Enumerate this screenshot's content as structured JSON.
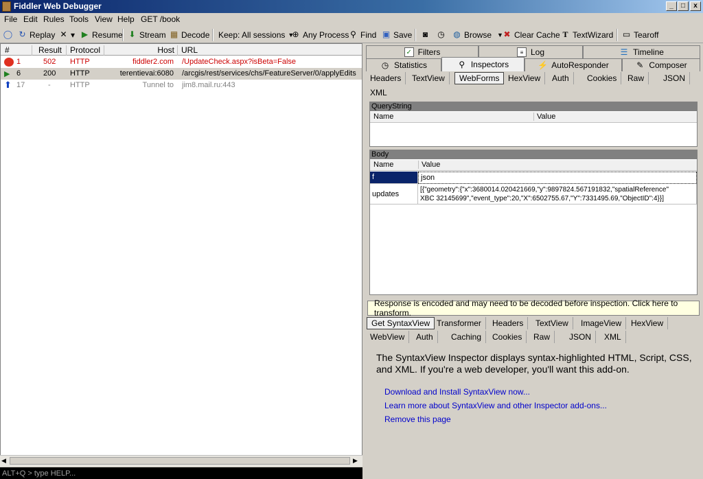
{
  "window": {
    "title": "Fiddler Web Debugger",
    "min": "_",
    "max": "□",
    "close": "x"
  },
  "menu": [
    "File",
    "Edit",
    "Rules",
    "Tools",
    "View",
    "Help",
    "GET /book"
  ],
  "toolbar": {
    "replay": "Replay",
    "remove": "▾",
    "resume": "Resume",
    "stream": "Stream",
    "decode": "Decode",
    "keep": "Keep: All sessions",
    "process": "Any Process",
    "find": "Find",
    "save": "Save",
    "browse": "Browse",
    "clear_cache": "Clear Cache",
    "textwizard": "TextWizard",
    "tearoff": "Tearoff"
  },
  "sessions": {
    "columns": [
      "#",
      "Result",
      "Protocol",
      "Host",
      "URL"
    ],
    "rows": [
      {
        "id": "1",
        "result": "502",
        "protocol": "HTTP",
        "host": "fiddler2.com",
        "url": "/UpdateCheck.aspx?isBeta=False",
        "color": "#cc0000"
      },
      {
        "id": "6",
        "result": "200",
        "protocol": "HTTP",
        "host": "terentievai:6080",
        "url": "/arcgis/rest/services/chs/FeatureServer/0/applyEdits",
        "color": "#000000"
      },
      {
        "id": "17",
        "result": "-",
        "protocol": "HTTP",
        "host": "Tunnel to",
        "url": "jim8.mail.ru:443",
        "color": "#808080"
      }
    ]
  },
  "quickexec": "ALT+Q > type HELP...",
  "tabs_top": [
    "Filters",
    "Log",
    "Timeline"
  ],
  "tabs_main": [
    "Statistics",
    "Inspectors",
    "AutoResponder",
    "Composer"
  ],
  "request_tabs": [
    "Headers",
    "TextView",
    "WebForms",
    "HexView",
    "Auth",
    "Cookies",
    "Raw",
    "JSON",
    "XML"
  ],
  "querystring": {
    "title": "QueryString",
    "col_name": "Name",
    "col_value": "Value"
  },
  "body": {
    "title": "Body",
    "col_name": "Name",
    "col_value": "Value",
    "rows": [
      {
        "name": "f",
        "value": "json"
      },
      {
        "name": "updates",
        "value_line1": "[{\"geometry\":{\"x\":3680014.020421669,\"y\":9897824.567191832,\"spatialReference\"",
        "value_line2": "XBC 32145699\",\"event_type\":20,\"X\":6502755.67,\"Y\":7331495.69,\"ObjectID\":4}}]"
      }
    ]
  },
  "warning": "Response is encoded and may need to be decoded before inspection. Click here to transform.",
  "response_tabs_row1": [
    "Get SyntaxView",
    "Transformer",
    "Headers",
    "TextView",
    "ImageView",
    "HexView"
  ],
  "response_tabs_row2": [
    "WebView",
    "Auth",
    "Caching",
    "Cookies",
    "Raw",
    "JSON",
    "XML"
  ],
  "syntaxview": {
    "message": "The SyntaxView Inspector displays syntax-highlighted HTML, Script, CSS, and XML. If you're a web developer, you'll want this add-on.",
    "link1": "Download and Install SyntaxView now...",
    "link2": "Learn more about SyntaxView and other Inspector add-ons...",
    "link3": "Remove this page"
  }
}
